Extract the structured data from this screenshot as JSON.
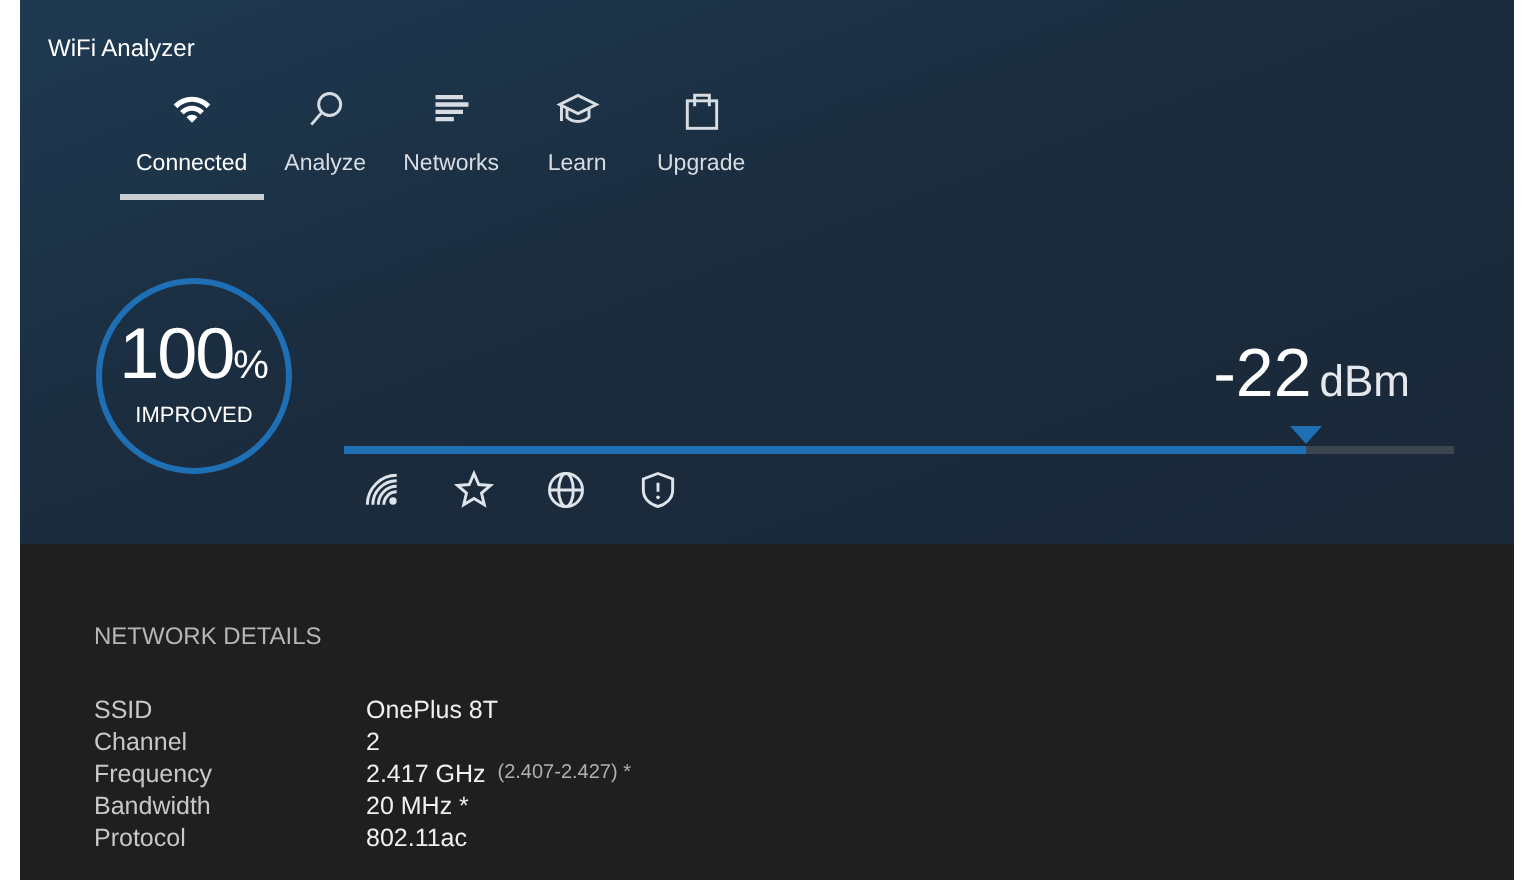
{
  "window": {
    "title": "WiFi Analyzer"
  },
  "tabs": [
    {
      "label": "Connected",
      "kind": "wifi",
      "selected": true
    },
    {
      "label": "Analyze",
      "kind": "search",
      "selected": false
    },
    {
      "label": "Networks",
      "kind": "bars",
      "selected": false
    },
    {
      "label": "Learn",
      "kind": "cap",
      "selected": false
    },
    {
      "label": "Upgrade",
      "kind": "bag",
      "selected": false
    }
  ],
  "score": {
    "value": "100",
    "unit": "%",
    "caption": "IMPROVED"
  },
  "signal": {
    "value": "-22",
    "unit": "dBm",
    "level": 0.867
  },
  "actions": [
    {
      "kind": "signal"
    },
    {
      "kind": "star"
    },
    {
      "kind": "globe"
    },
    {
      "kind": "shield"
    }
  ],
  "details": {
    "heading": "NETWORK DETAILS",
    "rows": [
      {
        "label": "SSID",
        "value": "OnePlus 8T"
      },
      {
        "label": "Channel",
        "value": "2"
      },
      {
        "label": "Frequency",
        "value": "2.417 GHz",
        "note": "(2.407-2.427) *"
      },
      {
        "label": "Bandwidth",
        "value": "20 MHz *"
      },
      {
        "label": "Protocol",
        "value": "802.11ac"
      }
    ]
  }
}
